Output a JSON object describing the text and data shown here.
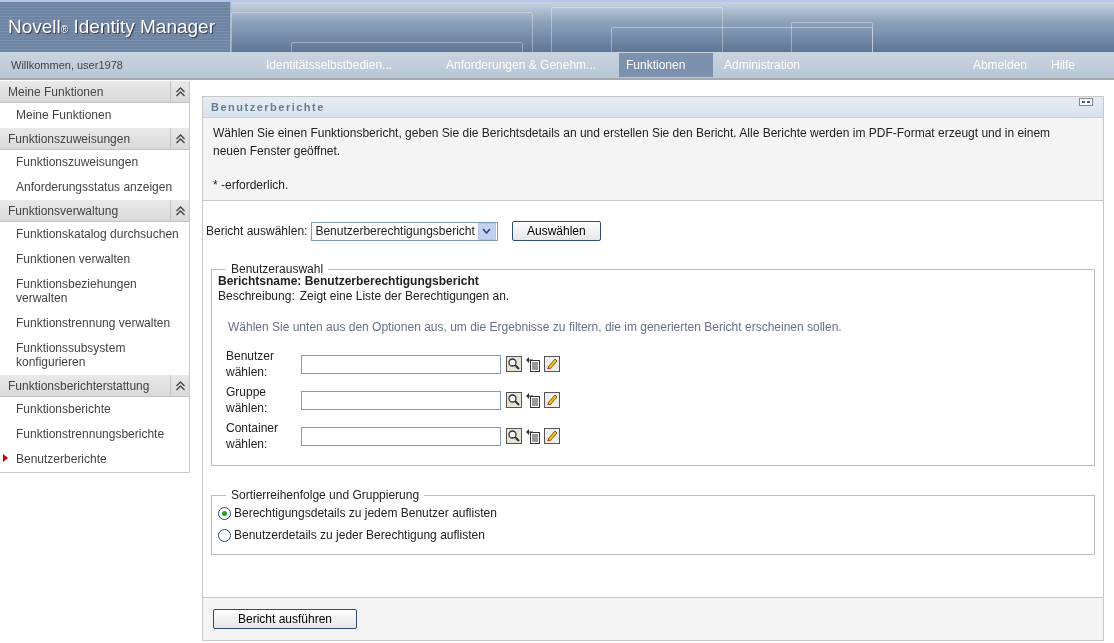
{
  "header": {
    "title": "Novell$_{®}$ Identity Manager",
    "welcome": "Willkommen, user1978"
  },
  "nav": [
    {
      "label": "Identitätsselbstbedien...",
      "selected": false
    },
    {
      "label": "Anforderungen & Genehm...",
      "selected": false
    },
    {
      "label": "Funktionen",
      "selected": true
    },
    {
      "label": "Administration",
      "selected": false
    }
  ],
  "nav_right": [
    "Abmelden",
    "Hilfe"
  ],
  "sidebar": [
    {
      "title": "Meine Funktionen",
      "expanded": true,
      "items": [
        {
          "label": "Meine Funktionen",
          "selected": false
        }
      ]
    },
    {
      "title": "Funktionszuweisungen",
      "expanded": true,
      "items": [
        {
          "label": "Funktionszuweisungen",
          "selected": false
        },
        {
          "label": "Anforderungsstatus anzeigen",
          "selected": false
        }
      ]
    },
    {
      "title": "Funktionsverwaltung",
      "expanded": true,
      "items": [
        {
          "label": "Funktionskatalog durchsuchen",
          "selected": false
        },
        {
          "label": "Funktionen verwalten",
          "selected": false
        },
        {
          "label": "Funktionsbeziehungen verwalten",
          "selected": false
        },
        {
          "label": "Funktionstrennung verwalten",
          "selected": false
        },
        {
          "label": "Funktionssubsystem konfigurieren",
          "selected": false
        }
      ]
    },
    {
      "title": "Funktionsberichterstattung",
      "expanded": true,
      "items": [
        {
          "label": "Funktionsberichte",
          "selected": false
        },
        {
          "label": "Funktionstrennungsberichte",
          "selected": false
        },
        {
          "label": "Benutzerberichte",
          "selected": true
        }
      ]
    }
  ],
  "panel": {
    "title": "Benutzerberichte",
    "intro": "Wählen Sie einen Funktionsbericht, geben Sie die Berichtsdetails an und erstellen Sie den Bericht. Alle Berichte werden im PDF-Format erzeugt und in einem neuen Fenster geöffnet.",
    "required_note": "* -erforderlich.",
    "report_label": "Bericht auswählen:",
    "report_value": "Benutzerberechtigungsbericht",
    "select_button": "Auswählen",
    "user_selection": {
      "legend": "Benutzerauswahl",
      "report_name": "**Berichtsname: Benutzerberechtigungsbericht**",
      "description_label": "Beschreibung:",
      "description": "Zeigt eine Liste der Berechtigungen an.",
      "hint": "Wählen Sie unten aus den Optionen aus, um die Ergebnisse zu filtern, die im generierten Bericht erscheinen sollen.",
      "pickers": [
        {
          "label": "Benutzer wählen:"
        },
        {
          "label": "Gruppe wählen:"
        },
        {
          "label": "Container wählen:"
        }
      ]
    },
    "sorting": {
      "legend": "Sortierreihenfolge und Gruppierung",
      "options": [
        {
          "label": "Berechtigungsdetails zu jedem Benutzer auflisten",
          "selected": true
        },
        {
          "label": "Benutzerdetails zu jeder Berechtigung auflisten",
          "selected": false
        }
      ]
    },
    "run_button": "Bericht ausführen"
  }
}
